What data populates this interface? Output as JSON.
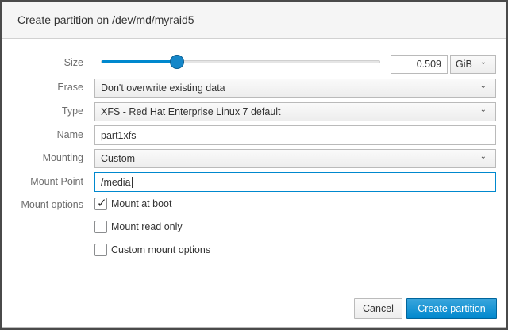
{
  "dialog": {
    "title": "Create partition on /dev/md/myraid5"
  },
  "fields": {
    "size": {
      "label": "Size",
      "slider_fraction": 0.27,
      "value": "0.509",
      "unit": "GiB"
    },
    "erase": {
      "label": "Erase",
      "value": "Don't overwrite existing data"
    },
    "type": {
      "label": "Type",
      "value": "XFS - Red Hat Enterprise Linux 7 default"
    },
    "name": {
      "label": "Name",
      "value": "part1xfs"
    },
    "mounting": {
      "label": "Mounting",
      "value": "Custom"
    },
    "mount_point": {
      "label": "Mount Point",
      "value": "/media"
    },
    "mount_options": {
      "label": "Mount options",
      "options": [
        {
          "label": "Mount at boot",
          "checked": true
        },
        {
          "label": "Mount read only",
          "checked": false
        },
        {
          "label": "Custom mount options",
          "checked": false
        }
      ]
    }
  },
  "buttons": {
    "cancel": "Cancel",
    "create": "Create partition"
  },
  "icons": {
    "chevron": "chevron-down-icon",
    "check": "checkmark-icon"
  },
  "colors": {
    "accent": "#0088ce"
  }
}
